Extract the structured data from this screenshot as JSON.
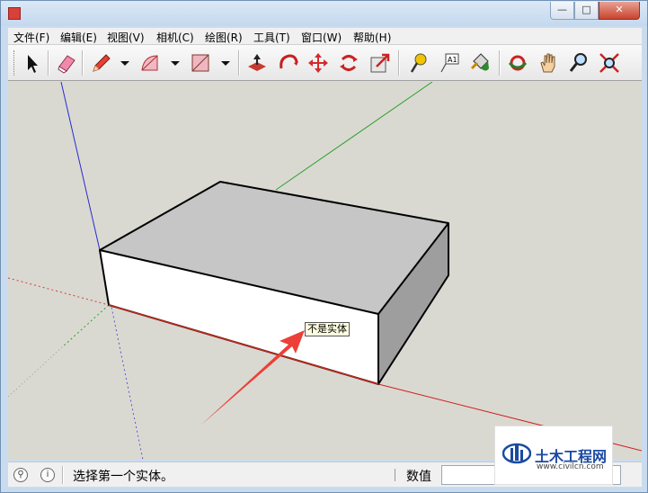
{
  "window": {
    "title": "",
    "minimize_glyph": "—",
    "maximize_glyph": "□",
    "close_glyph": "✕"
  },
  "menu": [
    {
      "label": "文件(F)"
    },
    {
      "label": "编辑(E)"
    },
    {
      "label": "视图(V)"
    },
    {
      "label": "相机(C)"
    },
    {
      "label": "绘图(R)"
    },
    {
      "label": "工具(T)"
    },
    {
      "label": "窗口(W)"
    },
    {
      "label": "帮助(H)"
    }
  ],
  "toolbar": {
    "tools": [
      "select-icon",
      "eraser-icon",
      "pencil-icon",
      "arc-icon",
      "rectangle-icon",
      "push-pull-icon",
      "rotate-icon",
      "move-icon",
      "follow-me-icon",
      "scale-icon",
      "tape-measure-icon",
      "text-label-icon",
      "paint-bucket-icon",
      "orbit-icon",
      "pan-icon",
      "zoom-icon",
      "zoom-extents-icon"
    ],
    "text_tool_label": "A1"
  },
  "viewport": {
    "background": "#d9d9d1",
    "tooltip": "不是实体"
  },
  "status": {
    "message": "选择第一个实体。",
    "measure_label": "数值",
    "measure_value": ""
  },
  "watermark": {
    "title": "土木工程网",
    "url": "www.civilcn.com"
  }
}
